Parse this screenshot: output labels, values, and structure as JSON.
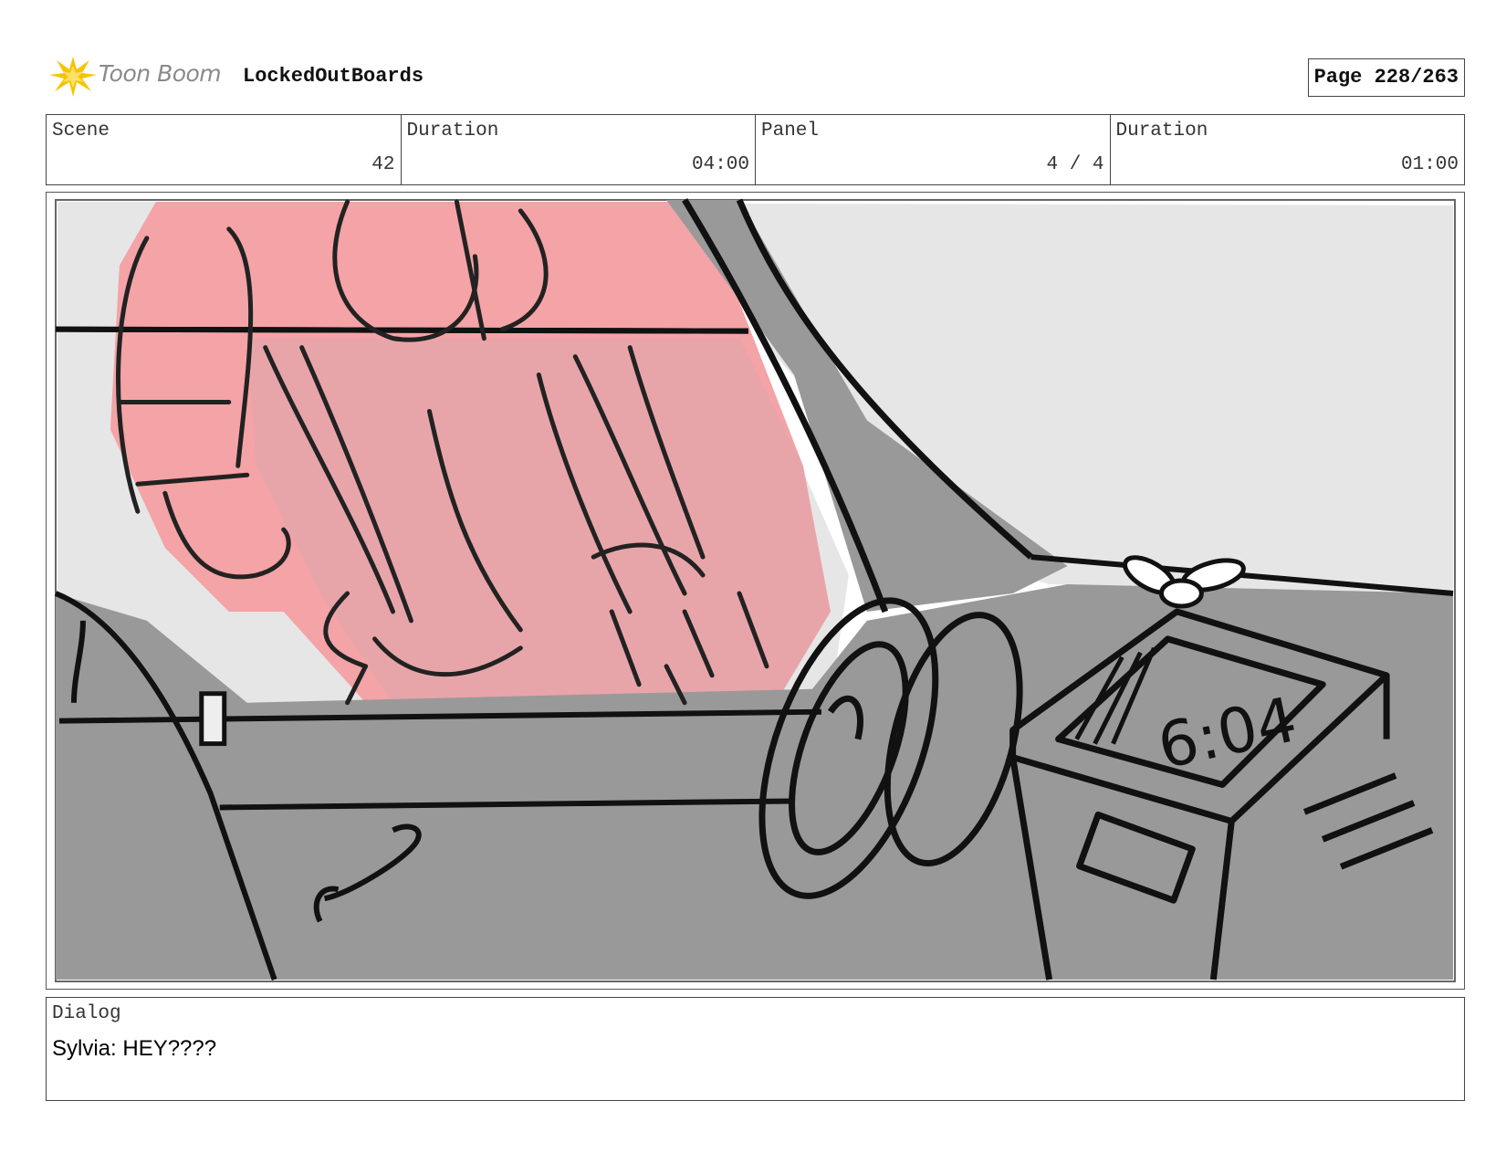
{
  "header": {
    "logo_text": "Toon Boom",
    "project_title": "LockedOutBoards",
    "page_label": "Page 228/263"
  },
  "info": {
    "scene_label": "Scene",
    "scene_value": "42",
    "scene_duration_label": "Duration",
    "scene_duration_value": "04:00",
    "panel_label": "Panel",
    "panel_value": "4 / 4",
    "panel_duration_label": "Duration",
    "panel_duration_value": "01:00"
  },
  "sketch": {
    "clock_text": "6:04"
  },
  "dialog": {
    "label": "Dialog",
    "text": "Sylvia: HEY????"
  },
  "colors": {
    "accent_logo": "#f5c400",
    "pink_fill": "#f4a3a6",
    "grey_fill": "#999999",
    "sky_fill": "#e6e6e6"
  }
}
